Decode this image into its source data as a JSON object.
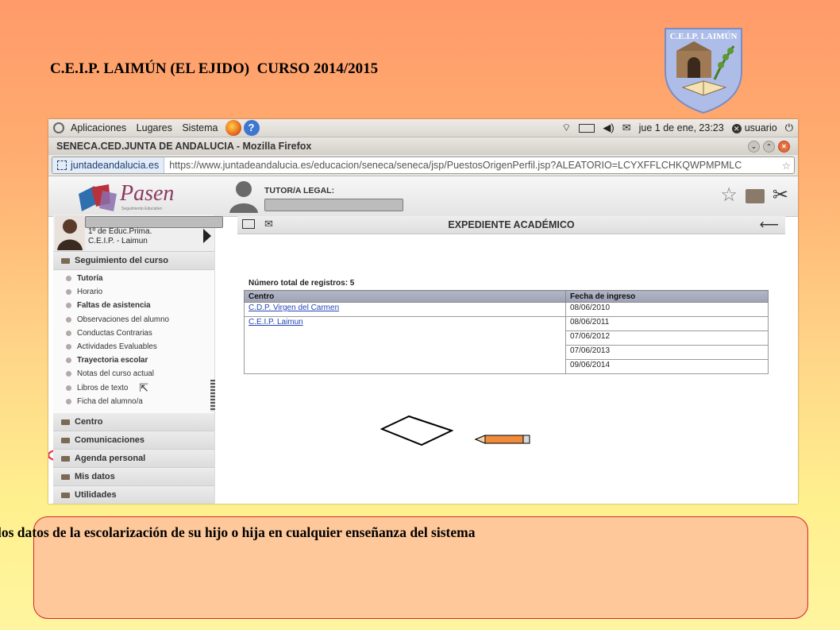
{
  "slide": {
    "title": "C.E.I.P. LAIMÚN (EL EJIDO)  CURSO 2014/2015",
    "logo_text": "C.E.I.P. LAIMÚN",
    "caption": "escolar, pueden acceder a los datos de la escolarización de su hijo o hija en cualquier enseñanza del sistema"
  },
  "desktop_panel": {
    "menus": [
      "Aplicaciones",
      "Lugares",
      "Sistema"
    ],
    "datetime": "jue  1 de ene, 23:23",
    "user": "usuario"
  },
  "browser": {
    "window_title": "SENECA.CED.JUNTA DE ANDALUCIA - Mozilla Firefox",
    "site_identity": "juntadeandalucia.es",
    "url": "https://www.juntadeandalucia.es/educacion/seneca/seneca/jsp/PuestosOrigenPerfil.jsp?ALEATORIO=LCYXFFLCHKQWPMPMLC"
  },
  "app": {
    "brand": "Pasen",
    "brand_tagline": "Seguimiento Educativo",
    "tutor_label": "TUTOR/A LEGAL:"
  },
  "student": {
    "line1": "1º de Educ.Prima.",
    "line2": "C.E.I.P. - Laimun"
  },
  "sidebar": {
    "section_seguimiento": "Seguimiento del curso",
    "items": [
      {
        "label": "Tutoría",
        "bold": true
      },
      {
        "label": "Horario",
        "bold": false
      },
      {
        "label": "Faltas de asistencia",
        "bold": true
      },
      {
        "label": "Observaciones del alumno",
        "bold": false
      },
      {
        "label": "Conductas Contrarias",
        "bold": false
      },
      {
        "label": "Actividades Evaluables",
        "bold": false
      },
      {
        "label": "Trayectoria escolar",
        "bold": true
      },
      {
        "label": "Notas del curso actual",
        "bold": false
      },
      {
        "label": "Libros de texto",
        "bold": false
      },
      {
        "label": "Ficha del alumno/a",
        "bold": false
      }
    ],
    "sections": [
      "Centro",
      "Comunicaciones",
      "Agenda personal",
      "Mis datos",
      "Utilidades"
    ]
  },
  "main": {
    "title": "EXPEDIENTE ACADÉMICO",
    "records_label": "Número total de registros: 5",
    "columns": [
      "Centro",
      "Fecha de ingreso"
    ],
    "rows": [
      {
        "centro": "C.D.P. Virgen del Carmen",
        "fecha": "08/06/2010"
      },
      {
        "centro": "C.E.I.P. Laimun",
        "fecha": "08/06/2011"
      },
      {
        "centro": "",
        "fecha": "07/06/2012"
      },
      {
        "centro": "",
        "fecha": "07/06/2013"
      },
      {
        "centro": "",
        "fecha": "09/06/2014"
      }
    ]
  }
}
